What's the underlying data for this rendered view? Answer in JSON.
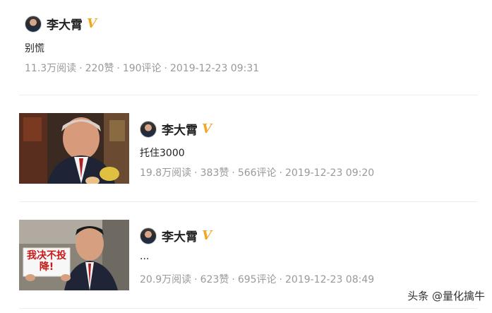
{
  "posts": [
    {
      "author": "李大霄",
      "verified_mark": "V",
      "text": "别慌",
      "reads": "11.3万阅读",
      "likes": "220赞",
      "comments": "190评论",
      "date": "2019-12-23 09:31"
    },
    {
      "author": "李大霄",
      "verified_mark": "V",
      "text": "托住3000",
      "reads": "19.8万阅读",
      "likes": "383赞",
      "comments": "566评论",
      "date": "2019-12-23 09:20"
    },
    {
      "author": "李大霄",
      "verified_mark": "V",
      "text": "...",
      "reads": "20.9万阅读",
      "likes": "623赞",
      "comments": "695评论",
      "date": "2019-12-23 08:49",
      "sign_text": "我决不投降!"
    }
  ],
  "meta_separator": "·",
  "watermark": "头条 @量化擒牛",
  "colors": {
    "verified": "#f0a820",
    "meta": "#999999",
    "divider": "#ececec"
  }
}
